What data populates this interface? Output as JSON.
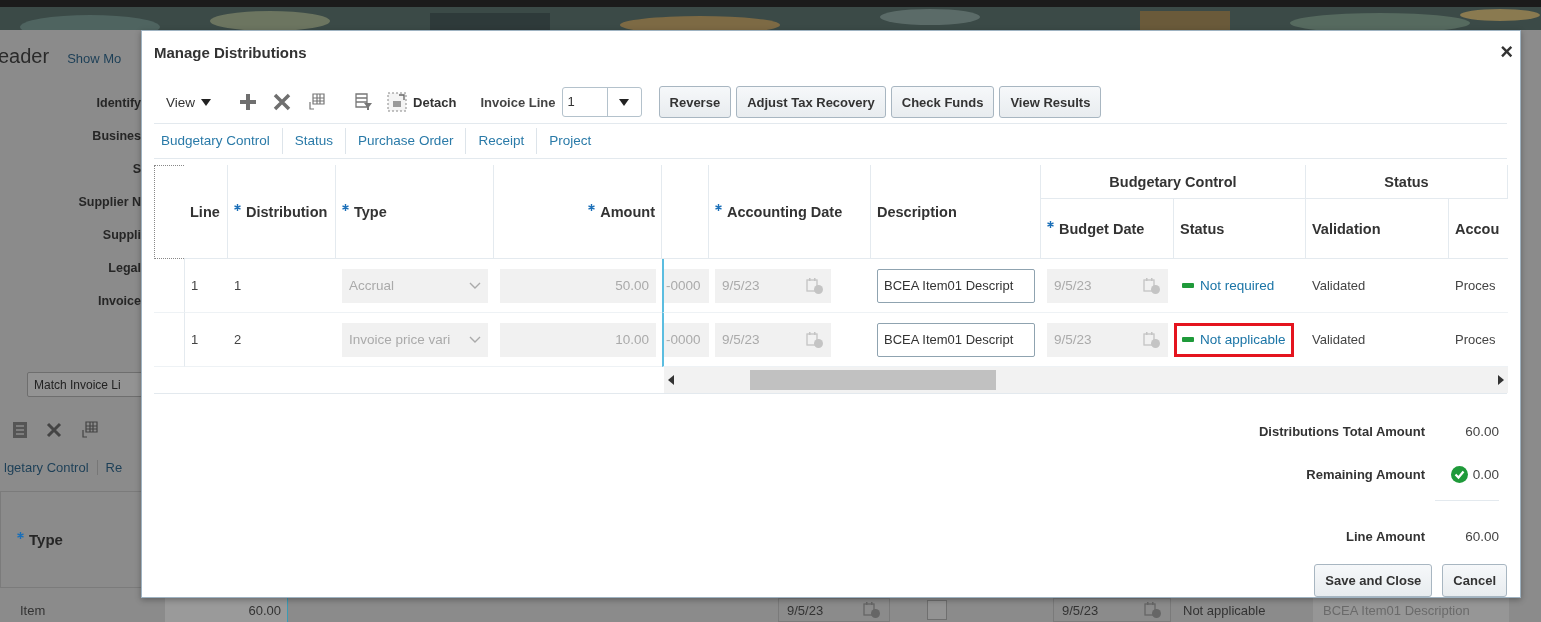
{
  "background_page": {
    "header_title": "eader",
    "header_link": "Show Mo",
    "field_labels": [
      "Identify",
      "Busines",
      "S",
      "Supplier N",
      "Suppli",
      "Legal",
      "Invoice"
    ],
    "match_button": "Match Invoice Li",
    "tabs": [
      "lgetary Control",
      "Re"
    ],
    "table_header": {
      "label": "Type",
      "required": true
    },
    "row": {
      "type": "Item",
      "amount": "60.00",
      "accounting_date": "9/5/23",
      "checked": false,
      "budget_date": "9/5/23",
      "status": "Not applicable",
      "description": "BCEA Item01 Description"
    }
  },
  "dialog": {
    "title": "Manage Distributions",
    "close": "×",
    "toolbar": {
      "view": "View",
      "detach": "Detach",
      "invoice_line_label": "Invoice Line",
      "invoice_line_value": "1",
      "buttons": [
        "Reverse",
        "Adjust Tax Recovery",
        "Check Funds",
        "View Results"
      ]
    },
    "tabs": [
      "Budgetary Control",
      "Status",
      "Purchase Order",
      "Receipt",
      "Project"
    ],
    "table": {
      "columns": [
        {
          "label": "Line",
          "required": false
        },
        {
          "label": "Distribution",
          "required": true
        },
        {
          "label": "Type",
          "required": true
        },
        {
          "label": "Amount",
          "required": true
        },
        {
          "label": "Accounting Date",
          "required": true
        },
        {
          "label": "Description",
          "required": false
        }
      ],
      "column_groups": [
        {
          "label": "Budgetary Control",
          "columns": [
            {
              "label": "Budget Date",
              "required": true
            },
            {
              "label": "Status",
              "required": false
            }
          ]
        },
        {
          "label": "Status",
          "columns": [
            {
              "label": "Validation",
              "required": false
            },
            {
              "label": "Accou",
              "required": false
            }
          ]
        }
      ],
      "rows": [
        {
          "line": "1",
          "distribution": "1",
          "type": "Accrual",
          "amount": "50.00",
          "column_5": "-0000",
          "accounting_date": "9/5/23",
          "description": "BCEA Item01 Descript",
          "budget_date": "9/5/23",
          "budget_status": "Not required",
          "highlighted": false,
          "validation": "Validated",
          "column_12": "Proces"
        },
        {
          "line": "1",
          "distribution": "2",
          "type": "Invoice price vari",
          "amount": "10.00",
          "column_5": "-0000",
          "accounting_date": "9/5/23",
          "description": "BCEA Item01 Descript",
          "budget_date": "9/5/23",
          "budget_status": "Not applicable",
          "highlighted": true,
          "validation": "Validated",
          "column_12": "Proces"
        }
      ]
    },
    "totals": [
      {
        "label": "Distributions Total Amount",
        "value": "60.00",
        "kind": "plain"
      },
      {
        "label": "Remaining Amount",
        "value": "0.00",
        "kind": "check"
      },
      {
        "label": "Line Amount",
        "value": "60.00",
        "kind": "plain"
      }
    ],
    "buttons": [
      "Save and Close",
      "Cancel"
    ]
  }
}
